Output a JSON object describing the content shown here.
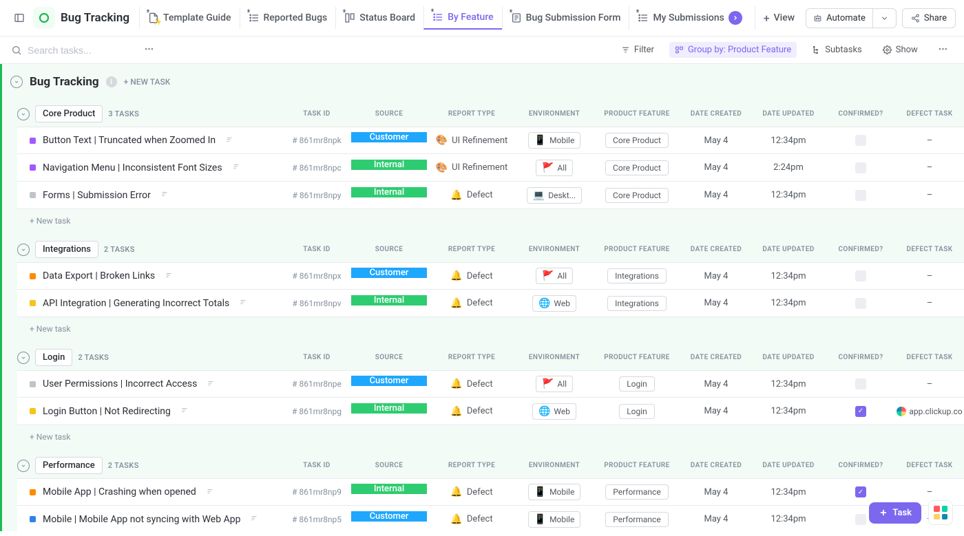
{
  "app": {
    "title": "Bug Tracking"
  },
  "tabs": [
    {
      "label": "Template Guide",
      "icon": "doc-sparkle"
    },
    {
      "label": "Reported Bugs",
      "icon": "list"
    },
    {
      "label": "Status Board",
      "icon": "board"
    },
    {
      "label": "By Feature",
      "icon": "list",
      "active": true
    },
    {
      "label": "Bug Submission Form",
      "icon": "form"
    },
    {
      "label": "My Submissions",
      "icon": "list-me",
      "truncated": true
    }
  ],
  "topRight": {
    "addView": "View",
    "automate": "Automate",
    "share": "Share"
  },
  "toolbar": {
    "searchPlaceholder": "Search tasks...",
    "filter": "Filter",
    "groupBy": "Group by: Product Feature",
    "subtasks": "Subtasks",
    "show": "Show"
  },
  "page": {
    "title": "Bug Tracking",
    "newTask": "+ NEW TASK"
  },
  "columns": {
    "taskId": "TASK ID",
    "source": "SOURCE",
    "reportType": "REPORT TYPE",
    "environment": "ENVIRONMENT",
    "productFeature": "PRODUCT FEATURE",
    "dateCreated": "DATE CREATED",
    "dateUpdated": "DATE UPDATED",
    "confirmed": "CONFIRMED?",
    "defectTask": "DEFECT TASK"
  },
  "sourceColors": {
    "Customer": "#1ea7fd",
    "Internal": "#2ecc71"
  },
  "reportConfig": {
    "UI Refinement": "🎨",
    "Defect": "🔔"
  },
  "envConfig": {
    "Mobile": "📱",
    "All": "🚩",
    "Desktop": "💻",
    "Web": "🌐"
  },
  "statusColors": {
    "purple": "#a259ff",
    "orange": "#ff8a00",
    "yellow": "#f5c518",
    "grey": "#bfc4cc",
    "blue": "#2f80ed"
  },
  "groups": [
    {
      "name": "Core Product",
      "count": "3 TASKS",
      "tasks": [
        {
          "status": "purple",
          "name": "Button Text | Truncated when Zoomed In",
          "taskId": "# 861mr8npk",
          "source": "Customer",
          "report": "UI Refinement",
          "env": "Mobile",
          "feature": "Core Product",
          "dateCreated": "May 4",
          "dateUpdated": "12:34pm",
          "confirmed": false,
          "defect": "–"
        },
        {
          "status": "purple",
          "name": "Navigation Menu | Inconsistent Font Sizes",
          "taskId": "# 861mr8npc",
          "source": "Internal",
          "report": "UI Refinement",
          "env": "All",
          "feature": "Core Product",
          "dateCreated": "May 4",
          "dateUpdated": "2:24pm",
          "confirmed": false,
          "defect": "–"
        },
        {
          "status": "grey",
          "name": "Forms | Submission Error",
          "taskId": "# 861mr8npy",
          "source": "Internal",
          "report": "Defect",
          "env": "Desktop",
          "envDisplay": "Deskt...",
          "feature": "Core Product",
          "dateCreated": "May 4",
          "dateUpdated": "12:34pm",
          "confirmed": false,
          "defect": "–"
        }
      ]
    },
    {
      "name": "Integrations",
      "count": "2 TASKS",
      "tasks": [
        {
          "status": "orange",
          "name": "Data Export | Broken Links",
          "taskId": "# 861mr8npx",
          "source": "Customer",
          "report": "Defect",
          "env": "All",
          "feature": "Integrations",
          "dateCreated": "May 4",
          "dateUpdated": "12:34pm",
          "confirmed": false,
          "defect": "–"
        },
        {
          "status": "yellow",
          "name": "API Integration | Generating Incorrect Totals",
          "taskId": "# 861mr8npv",
          "source": "Internal",
          "report": "Defect",
          "env": "Web",
          "feature": "Integrations",
          "dateCreated": "May 4",
          "dateUpdated": "12:34pm",
          "confirmed": false,
          "defect": "–"
        }
      ]
    },
    {
      "name": "Login",
      "count": "2 TASKS",
      "tasks": [
        {
          "status": "grey",
          "name": "User Permissions | Incorrect Access",
          "taskId": "# 861mr8npe",
          "source": "Customer",
          "report": "Defect",
          "env": "All",
          "feature": "Login",
          "dateCreated": "May 4",
          "dateUpdated": "12:34pm",
          "confirmed": false,
          "defect": "–"
        },
        {
          "status": "yellow",
          "name": "Login Button | Not Redirecting",
          "taskId": "# 861mr8npg",
          "source": "Internal",
          "report": "Defect",
          "env": "Web",
          "feature": "Login",
          "dateCreated": "May 4",
          "dateUpdated": "12:34pm",
          "confirmed": true,
          "defect": "app.clickup.co",
          "defectLink": true
        }
      ]
    },
    {
      "name": "Performance",
      "count": "2 TASKS",
      "hideNewTask": true,
      "tasks": [
        {
          "status": "orange",
          "name": "Mobile App | Crashing when opened",
          "taskId": "# 861mr8np9",
          "source": "Internal",
          "report": "Defect",
          "env": "Mobile",
          "feature": "Performance",
          "dateCreated": "May 4",
          "dateUpdated": "12:34pm",
          "confirmed": true,
          "defect": "–"
        },
        {
          "status": "blue",
          "name": "Mobile | Mobile App not syncing with Web App",
          "taskId": "# 861mr8np5",
          "source": "Customer",
          "report": "Defect",
          "env": "Mobile",
          "feature": "Performance",
          "dateCreated": "May 4",
          "dateUpdated": "12:34pm",
          "confirmed": false,
          "defect": "–"
        }
      ]
    }
  ],
  "misc": {
    "newTaskInline": "+ New task"
  },
  "fab": {
    "task": "Task"
  }
}
